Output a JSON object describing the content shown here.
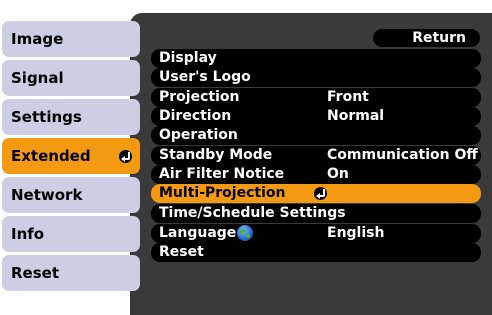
{
  "tabs": [
    {
      "label": "Image",
      "active": false
    },
    {
      "label": "Signal",
      "active": false
    },
    {
      "label": "Settings",
      "active": false
    },
    {
      "label": "Extended",
      "active": true
    },
    {
      "label": "Network",
      "active": false
    },
    {
      "label": "Info",
      "active": false
    },
    {
      "label": "Reset",
      "active": false
    }
  ],
  "return_label": "Return",
  "menu": [
    {
      "label": "Display",
      "value": ""
    },
    {
      "label": "User's Logo",
      "value": ""
    },
    {
      "label": "Projection",
      "value": "Front"
    },
    {
      "label": "Direction",
      "value": "Normal"
    },
    {
      "label": "Operation",
      "value": ""
    },
    {
      "label": "Standby Mode",
      "value": "Communication Off"
    },
    {
      "label": "Air Filter Notice",
      "value": "On"
    },
    {
      "label": "Multi-Projection",
      "value": "",
      "selected": true
    },
    {
      "label": "Time/Schedule Settings",
      "value": ""
    },
    {
      "label": "Language",
      "value": "English"
    },
    {
      "label": "Reset",
      "value": ""
    }
  ],
  "icons": {
    "enter": "enter-icon",
    "globe": "globe-icon"
  },
  "colors": {
    "accent": "#f39a12",
    "tab_bg": "#cdcde3",
    "panel_bg": "#3a3a3a",
    "item_bg": "#000000"
  }
}
